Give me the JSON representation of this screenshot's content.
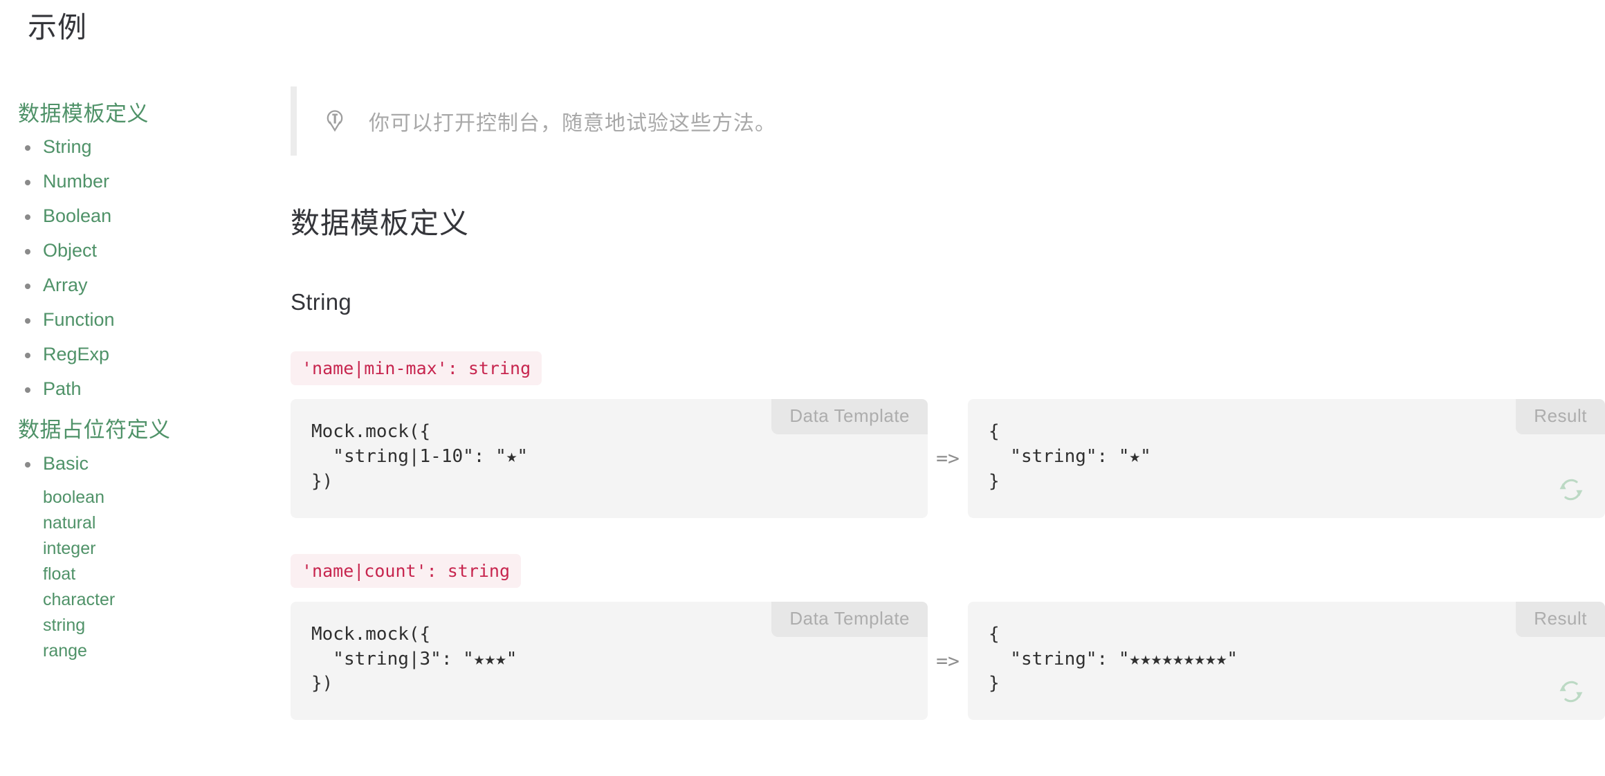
{
  "page": {
    "title": "示例"
  },
  "sidebar": {
    "sections": [
      {
        "heading": "数据模板定义",
        "items": [
          {
            "label": "String"
          },
          {
            "label": "Number"
          },
          {
            "label": "Boolean"
          },
          {
            "label": "Object"
          },
          {
            "label": "Array"
          },
          {
            "label": "Function"
          },
          {
            "label": "RegExp"
          },
          {
            "label": "Path"
          }
        ]
      },
      {
        "heading": "数据占位符定义",
        "items": [
          {
            "label": "Basic"
          }
        ],
        "subitems": [
          {
            "label": "boolean"
          },
          {
            "label": "natural"
          },
          {
            "label": "integer"
          },
          {
            "label": "float"
          },
          {
            "label": "character"
          },
          {
            "label": "string"
          },
          {
            "label": "range"
          }
        ]
      }
    ]
  },
  "main": {
    "tip": {
      "icon": "lightbulb-icon",
      "text": "你可以打开控制台，随意地试验这些方法。"
    },
    "section_heading": "数据模板定义",
    "subsection_heading": "String",
    "arrow": "=>",
    "labels": {
      "data_template": "Data Template",
      "result": "Result"
    },
    "examples": [
      {
        "signature": "'name|min-max': string",
        "template_code": "Mock.mock({\n  \"string|1-10\": \"★\"\n})",
        "result_code": "{\n  \"string\": \"★\"\n}"
      },
      {
        "signature": "'name|count': string",
        "template_code": "Mock.mock({\n  \"string|3\": \"★★★\"\n})",
        "result_code": "{\n  \"string\": \"★★★★★★★★★\"\n}"
      }
    ]
  },
  "colors": {
    "accent_green": "#4f9268",
    "code_red": "#c7254e",
    "code_bg": "#fbf0f2",
    "panel_bg": "#f4f4f4",
    "label_bg": "#e7e7e7",
    "text_dark": "#34353a",
    "muted": "#a8a8a8"
  }
}
